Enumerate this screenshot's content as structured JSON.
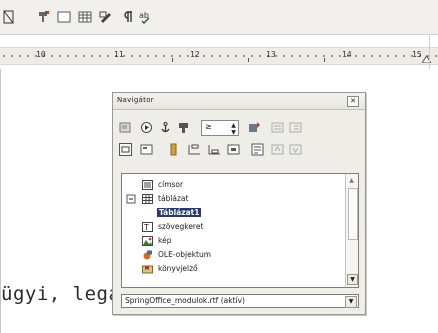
{
  "ruler": {
    "numbers": [
      "10",
      "11",
      "12",
      "13",
      "14",
      "15"
    ]
  },
  "document": {
    "text_line": "ügyi, legalább olyan fontos"
  },
  "navigator": {
    "title": "Navigátor",
    "close_glyph": "✕",
    "spin_value": "≥",
    "spin_arrows": "▲▼",
    "tree": {
      "items": [
        {
          "label": "címsor",
          "icon": "heading-icon"
        },
        {
          "label": "táblázat",
          "icon": "table-icon"
        },
        {
          "label": "Táblázat1",
          "icon": "",
          "selected": true
        },
        {
          "label": "szövegkeret",
          "icon": "text-frame-icon"
        },
        {
          "label": "kép",
          "icon": "image-icon"
        },
        {
          "label": "OLE-objektum",
          "icon": "ole-object-icon"
        },
        {
          "label": "könyvjelző",
          "icon": "bookmark-icon"
        }
      ],
      "scroll_down": "▼",
      "scroll_up": "▲"
    },
    "document_combo": {
      "value": "SpringOffice_modulok.rtf (aktív)",
      "arrow": "▼"
    }
  },
  "colors": {
    "selection": "#2a3a68",
    "window_bg": "#eeede8"
  }
}
